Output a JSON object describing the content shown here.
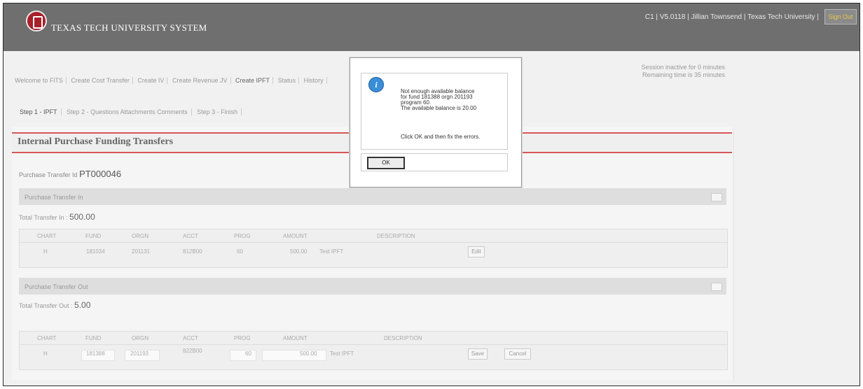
{
  "header": {
    "brand": "TEXAS TECH UNIVERSITY SYSTEM",
    "user_info": "C1 | V5.0118 | Jillian Townsend | Texas Tech University |",
    "sign_out": "Sign Out"
  },
  "session": {
    "line1": "Session inactive for 0 minutes",
    "line2": "Remaining time is 35 minutes"
  },
  "tabs": [
    "Welcome to FiTS",
    "Create Cost Transfer",
    "Create IV",
    "Create Revenue JV",
    "Create IPFT",
    "Status",
    "History"
  ],
  "steps": [
    "Step 1 - IPFT",
    "Step 2 - Questions Attachments Comments",
    "Step 3 - Finish"
  ],
  "page_title": "Internal Purchase Funding Transfers",
  "purchase_transfer_id_label": "Purchase Transfer Id",
  "purchase_transfer_id": "PT000046",
  "transfer_in": {
    "title": "Purchase Transfer In",
    "total_label": "Total Transfer In :",
    "total": "500.00",
    "columns": [
      "CHART",
      "FUND",
      "ORGN",
      "ACCT",
      "PROG",
      "AMOUNT",
      "DESCRIPTION"
    ],
    "row": {
      "chart": "H",
      "fund": "181034",
      "orgn": "201131",
      "acct": "812B00",
      "prog": "60",
      "amount": "500.00",
      "description": "Test IPFT",
      "edit": "Edit"
    }
  },
  "transfer_out": {
    "title": "Purchase Transfer Out",
    "total_label": "Total Transfer Out :",
    "total": "5.00",
    "columns": [
      "CHART",
      "FUND",
      "ORGN",
      "ACCT",
      "PROG",
      "AMOUNT",
      "DESCRIPTION"
    ],
    "row": {
      "chart": "H",
      "fund": "181388",
      "orgn": "201193",
      "acct": "822B00",
      "prog": "60",
      "amount": "500.00",
      "description": "Test IPFT",
      "save": "Save",
      "cancel": "Cancel"
    }
  },
  "dialog": {
    "icon": "info-icon",
    "message": [
      "Not enough available balance",
      "for fund 181388 orgn 201193",
      "program 60.",
      "The available balance is 20.00"
    ],
    "instruction": "Click OK and then fix the errors.",
    "ok": "OK"
  }
}
